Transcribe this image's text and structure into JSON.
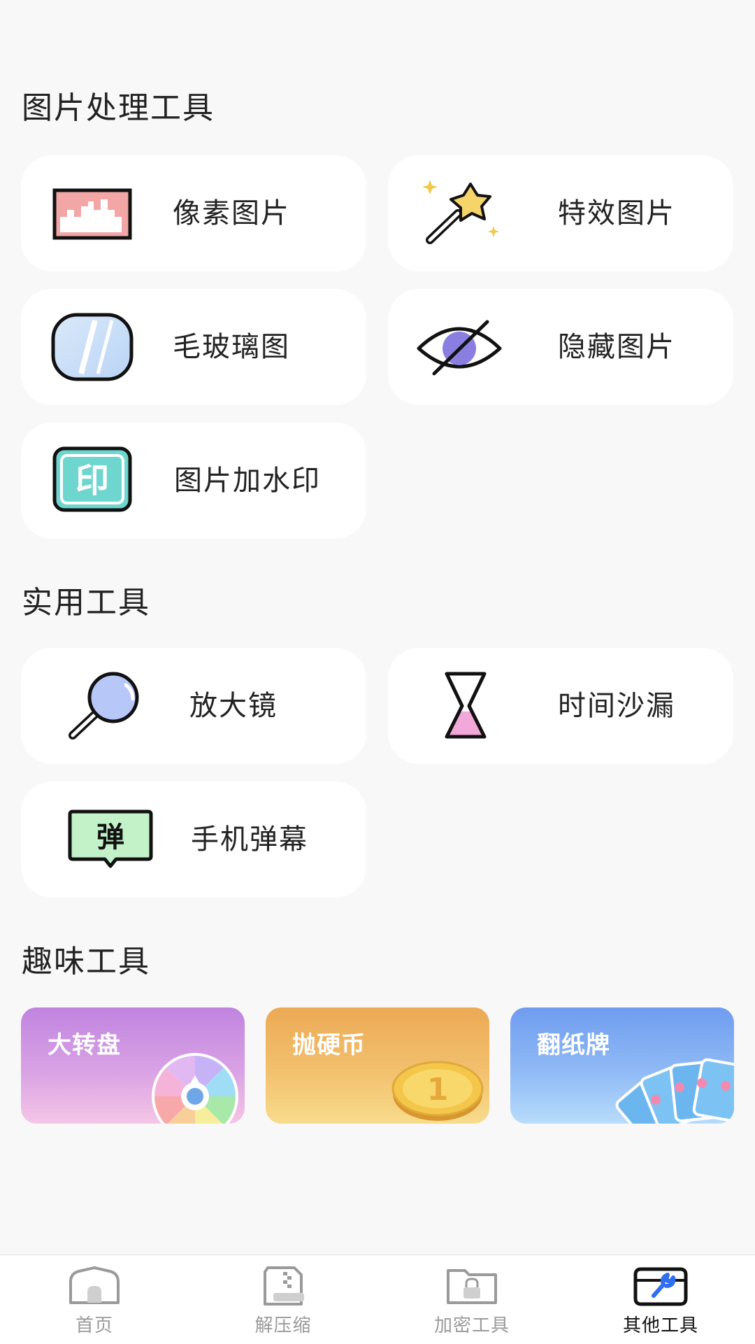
{
  "sections": {
    "image_tools": "图片处理工具",
    "practical_tools": "实用工具",
    "fun_tools": "趣味工具"
  },
  "image_tools": [
    {
      "label": "像素图片",
      "icon": "pixel-image-icon"
    },
    {
      "label": "特效图片",
      "icon": "magic-wand-icon"
    },
    {
      "label": "毛玻璃图",
      "icon": "frosted-glass-icon"
    },
    {
      "label": "隐藏图片",
      "icon": "hidden-eye-icon"
    },
    {
      "label": "图片加水印",
      "icon": "watermark-stamp-icon",
      "icon_text": "印"
    }
  ],
  "practical_tools": [
    {
      "label": "放大镜",
      "icon": "magnifier-icon"
    },
    {
      "label": "时间沙漏",
      "icon": "hourglass-icon"
    },
    {
      "label": "手机弹幕",
      "icon": "danmaku-icon",
      "icon_text": "弹"
    }
  ],
  "fun_tools": [
    {
      "label": "大转盘",
      "icon": "spin-wheel-icon",
      "gradient": [
        "#c084e0",
        "#f5c6e6"
      ]
    },
    {
      "label": "抛硬币",
      "icon": "coin-icon",
      "gradient": [
        "#ecaa55",
        "#f7dc8c"
      ],
      "coin_text": "1"
    },
    {
      "label": "翻纸牌",
      "icon": "cards-icon",
      "gradient": [
        "#6f9cf0",
        "#b8dcfb"
      ]
    }
  ],
  "tabs": [
    {
      "label": "首页",
      "icon": "home-icon",
      "active": false
    },
    {
      "label": "解压缩",
      "icon": "zip-file-icon",
      "active": false
    },
    {
      "label": "加密工具",
      "icon": "lock-folder-icon",
      "active": false
    },
    {
      "label": "其他工具",
      "icon": "toolbox-icon",
      "active": true
    }
  ],
  "colors": {
    "background": "#f8f8f8",
    "card": "#ffffff",
    "text": "#222222",
    "tab_inactive": "#9a9a9a",
    "tab_active": "#111111"
  }
}
